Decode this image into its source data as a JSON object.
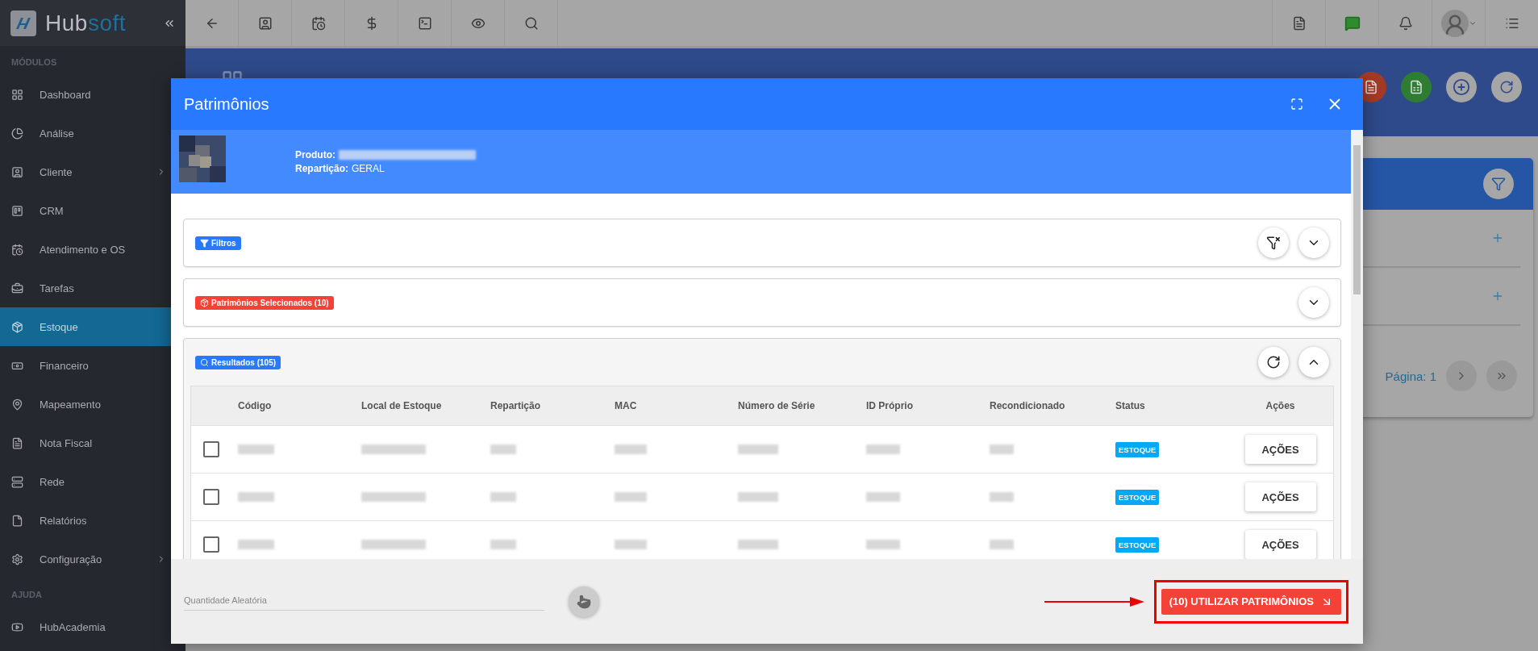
{
  "sidebar": {
    "logo": {
      "first": "Hub",
      "second": "soft"
    },
    "sections": [
      {
        "heading": "MÓDULOS",
        "items": [
          {
            "label": "Dashboard",
            "selected": false,
            "has_submenu": false
          },
          {
            "label": "Análise",
            "selected": false,
            "has_submenu": false
          },
          {
            "label": "Cliente",
            "selected": false,
            "has_submenu": true
          },
          {
            "label": "CRM",
            "selected": false,
            "has_submenu": false
          },
          {
            "label": "Atendimento e OS",
            "selected": false,
            "has_submenu": false
          },
          {
            "label": "Tarefas",
            "selected": false,
            "has_submenu": false
          },
          {
            "label": "Estoque",
            "selected": true,
            "has_submenu": false
          },
          {
            "label": "Financeiro",
            "selected": false,
            "has_submenu": false
          },
          {
            "label": "Mapeamento",
            "selected": false,
            "has_submenu": false
          },
          {
            "label": "Nota Fiscal",
            "selected": false,
            "has_submenu": false
          },
          {
            "label": "Rede",
            "selected": false,
            "has_submenu": false
          },
          {
            "label": "Relatórios",
            "selected": false,
            "has_submenu": false
          },
          {
            "label": "Configuração",
            "selected": false,
            "has_submenu": true
          }
        ]
      },
      {
        "heading": "AJUDA",
        "items": [
          {
            "label": "HubAcademia",
            "selected": false,
            "has_submenu": false
          }
        ]
      }
    ]
  },
  "page": {
    "pagination": {
      "page": "Página: 1"
    }
  },
  "modal": {
    "title": "Patrimônios",
    "product": {
      "product_label": "Produto:",
      "partition_label": "Repartição:",
      "partition_value": "GERAL"
    },
    "sections": [
      {
        "kind": "filters",
        "badge": "Filtros",
        "color": "#2979ff",
        "expanded": false
      },
      {
        "kind": "selected",
        "badge": "Patrimônios Selecionados (10)",
        "color": "#f44336",
        "expanded": false
      },
      {
        "kind": "results",
        "badge": "Resultados (105)",
        "color": "#2979ff",
        "expanded": true
      }
    ],
    "table": {
      "columns": [
        "Código",
        "Local de Estoque",
        "Repartição",
        "MAC",
        "Número de Série",
        "ID Próprio",
        "Recondicionado",
        "Status",
        "Ações"
      ],
      "rows": [
        {
          "checked": false,
          "status": "ESTOQUE",
          "action": "AÇÕES"
        },
        {
          "checked": false,
          "status": "ESTOQUE",
          "action": "AÇÕES"
        },
        {
          "checked": false,
          "status": "ESTOQUE",
          "action": "AÇÕES"
        }
      ]
    },
    "footer": {
      "quantity_placeholder": "Quantidade Aleatória",
      "submit": "(10) UTILIZAR PATRIMÔNIOS"
    }
  }
}
